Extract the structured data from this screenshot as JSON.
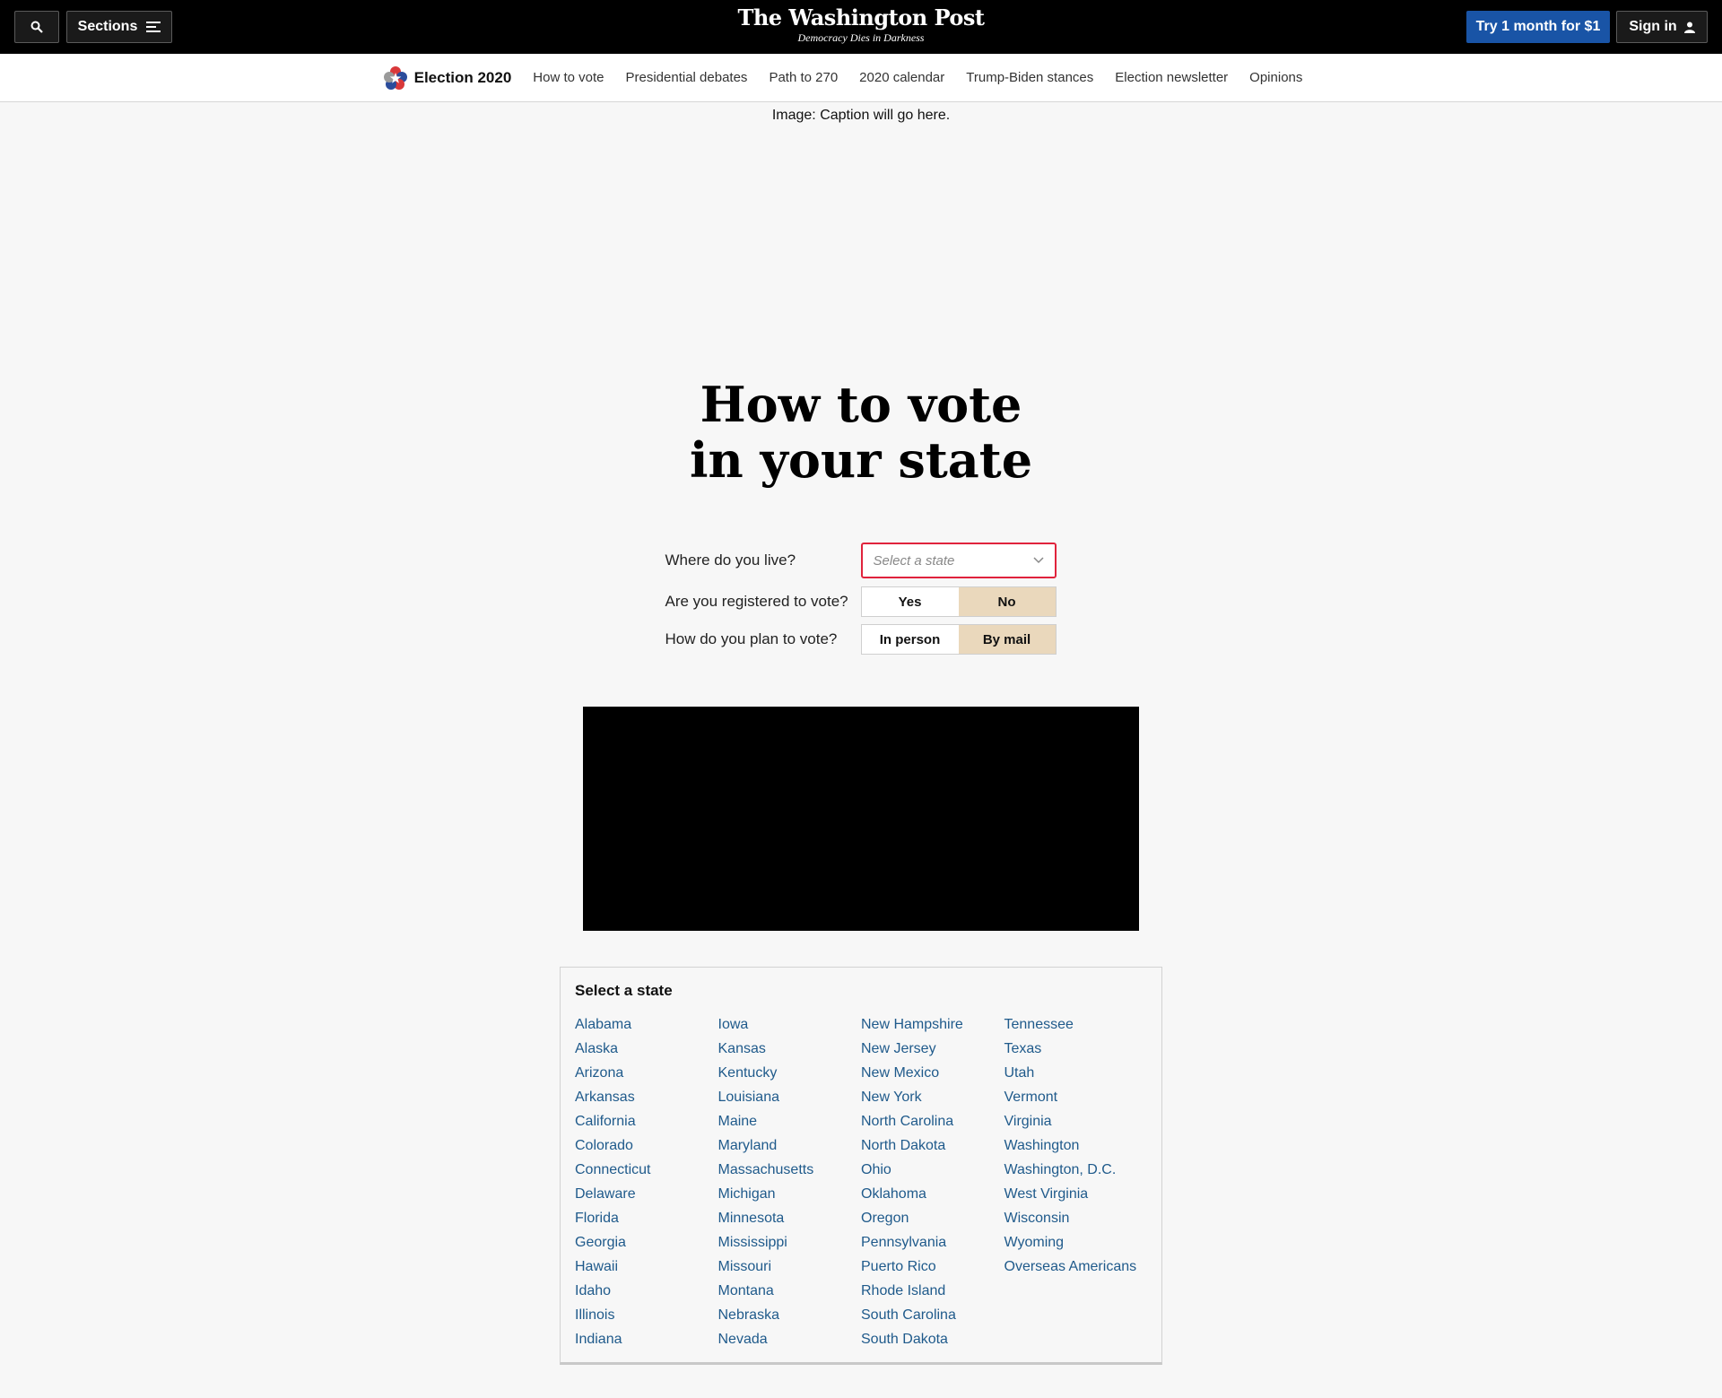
{
  "masthead": {
    "sections_label": "Sections",
    "logo_name": "The Washington Post",
    "logo_tagline": "Democracy Dies in Darkness",
    "try_label": "Try 1 month for $1",
    "signin_label": "Sign in"
  },
  "subnav": {
    "brand": "Election 2020",
    "links": [
      "How to vote",
      "Presidential debates",
      "Path to 270",
      "2020 calendar",
      "Trump-Biden stances",
      "Election newsletter",
      "Opinions"
    ]
  },
  "image_caption": "Image: Caption will go here.",
  "headline": {
    "line1": "How to vote",
    "line2": "in your state"
  },
  "form": {
    "q_live": "Where do you live?",
    "select_placeholder": "Select a state",
    "q_registered": "Are you registered to vote?",
    "registered_yes": "Yes",
    "registered_no": "No",
    "q_plan": "How do you plan to vote?",
    "plan_person": "In person",
    "plan_mail": "By mail"
  },
  "states": {
    "title": "Select a state",
    "columns": [
      [
        "Alabama",
        "Alaska",
        "Arizona",
        "Arkansas",
        "California",
        "Colorado",
        "Connecticut",
        "Delaware",
        "Florida",
        "Georgia",
        "Hawaii",
        "Idaho",
        "Illinois",
        "Indiana"
      ],
      [
        "Iowa",
        "Kansas",
        "Kentucky",
        "Louisiana",
        "Maine",
        "Maryland",
        "Massachusetts",
        "Michigan",
        "Minnesota",
        "Mississippi",
        "Missouri",
        "Montana",
        "Nebraska",
        "Nevada"
      ],
      [
        "New Hampshire",
        "New Jersey",
        "New Mexico",
        "New York",
        "North Carolina",
        "North Dakota",
        "Ohio",
        "Oklahoma",
        "Oregon",
        "Pennsylvania",
        "Puerto Rico",
        "Rhode Island",
        "South Carolina",
        "South Dakota"
      ],
      [
        "Tennessee",
        "Texas",
        "Utah",
        "Vermont",
        "Virginia",
        "Washington",
        "Washington, D.C.",
        "West Virginia",
        "Wisconsin",
        "Wyoming",
        "Overseas Americans"
      ]
    ]
  },
  "colors": {
    "accent_blue": "#1954a6",
    "link_blue": "#1f5a8b",
    "select_border": "#e0233c",
    "selected_option": "#ead8bc"
  }
}
